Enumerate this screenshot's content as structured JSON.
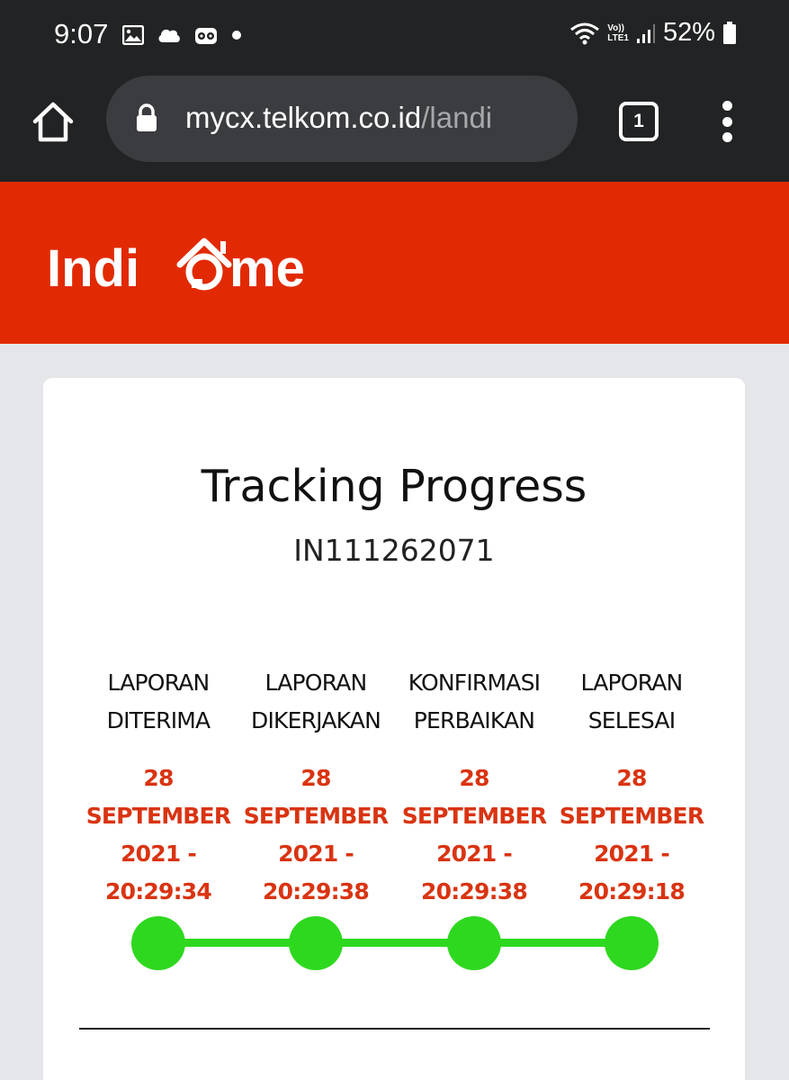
{
  "status_bar": {
    "time": "9:07",
    "left_icons": [
      "image-icon",
      "cloud-icon",
      "tripadvisor-icon",
      "dot-icon"
    ],
    "lte_top": "Vo))",
    "lte_bottom": "LTE1",
    "battery": "52%"
  },
  "browser": {
    "url_domain": "mycx.telkom.co.id",
    "url_path": "/landi",
    "tab_count": "1"
  },
  "header": {
    "logo_text": "IndiHome",
    "brand_color": "#e12a03"
  },
  "card": {
    "title": "Tracking Progress",
    "ticket_id": "IN111262071"
  },
  "steps": [
    {
      "label": "LAPORAN\nDITERIMA",
      "date_lines": [
        "28",
        "SEPTEMBER",
        "2021 -",
        "20:29:34"
      ],
      "completed": true
    },
    {
      "label": "LAPORAN\nDIKERJAKAN",
      "date_lines": [
        "28",
        "SEPTEMBER",
        "2021 -",
        "20:29:38"
      ],
      "completed": true
    },
    {
      "label": "KONFIRMASI\nPERBAIKAN",
      "date_lines": [
        "28",
        "SEPTEMBER",
        "2021 -",
        "20:29:38"
      ],
      "completed": true
    },
    {
      "label": "LAPORAN\nSELESAI",
      "date_lines": [
        "28",
        "SEPTEMBER",
        "2021 -",
        "20:29:18"
      ],
      "completed": true
    }
  ],
  "colors": {
    "progress": "#2ed81f",
    "date_text": "#d93412"
  }
}
